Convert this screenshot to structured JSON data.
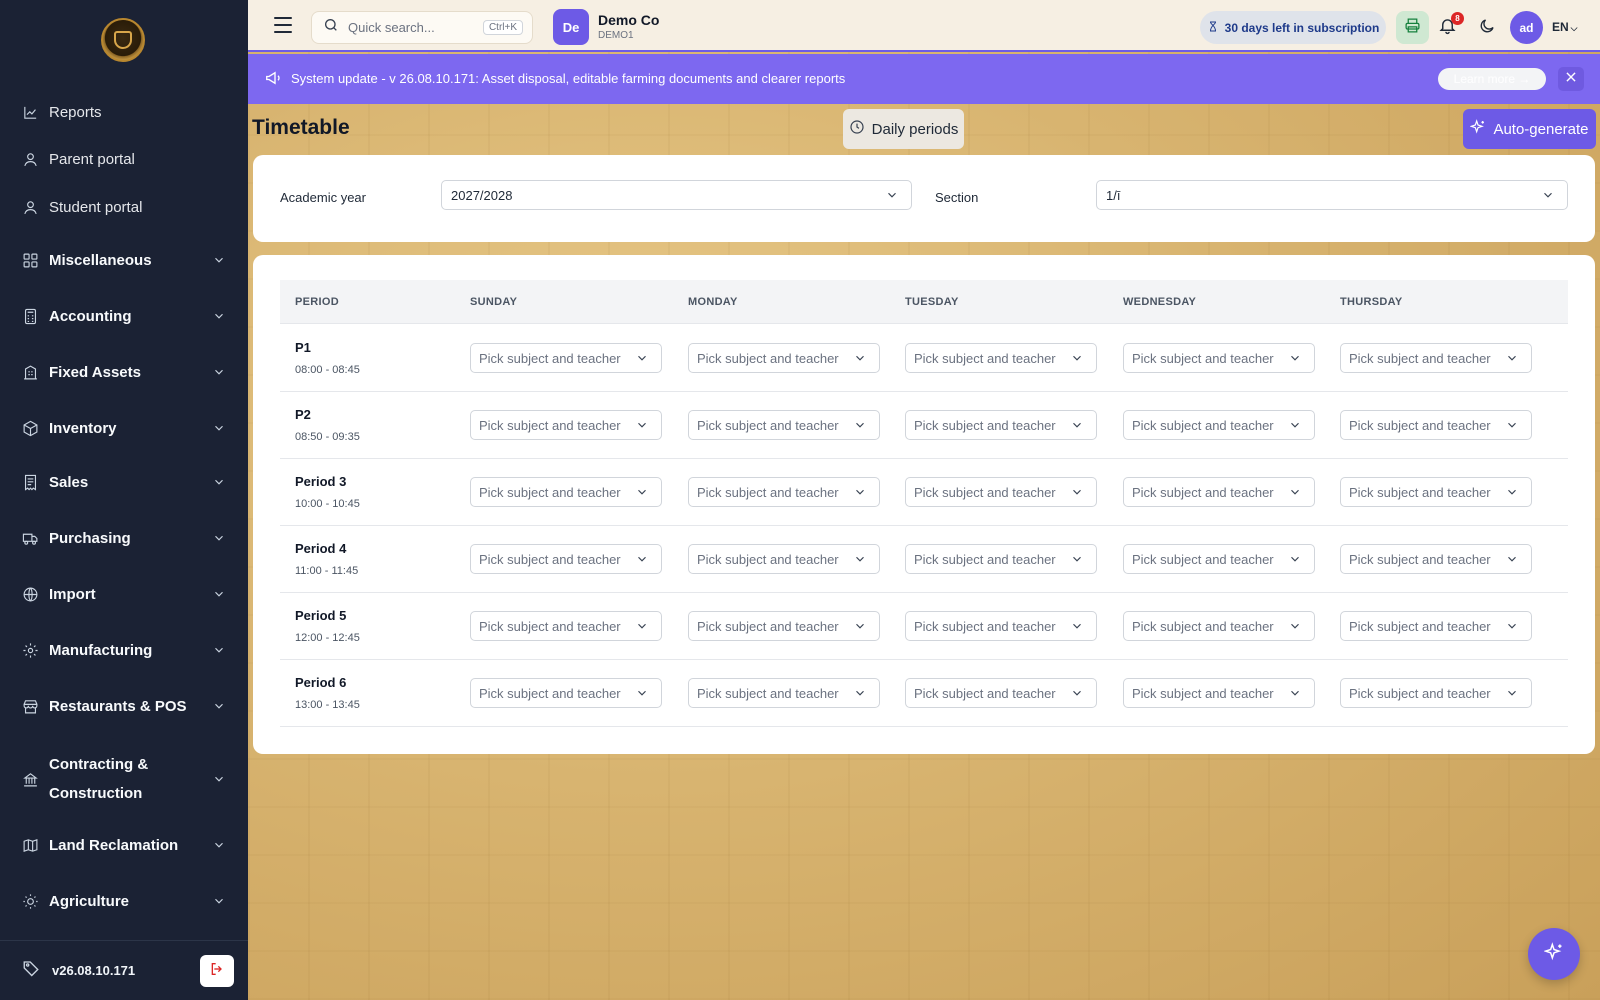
{
  "sidebar": {
    "items": [
      {
        "label": "Reports",
        "icon": "chart-line-icon",
        "bold": false,
        "expandable": false
      },
      {
        "label": "Parent portal",
        "icon": "user-icon",
        "bold": false,
        "expandable": false
      },
      {
        "label": "Student portal",
        "icon": "user-icon",
        "bold": false,
        "expandable": false
      },
      {
        "label": "Miscellaneous",
        "icon": "grid-icon",
        "bold": true,
        "expandable": true
      },
      {
        "label": "Accounting",
        "icon": "calculator-icon",
        "bold": true,
        "expandable": true
      },
      {
        "label": "Fixed Assets",
        "icon": "building-icon",
        "bold": true,
        "expandable": true
      },
      {
        "label": "Inventory",
        "icon": "box-icon",
        "bold": true,
        "expandable": true
      },
      {
        "label": "Sales",
        "icon": "receipt-icon",
        "bold": true,
        "expandable": true
      },
      {
        "label": "Purchasing",
        "icon": "truck-icon",
        "bold": true,
        "expandable": true
      },
      {
        "label": "Import",
        "icon": "globe-icon",
        "bold": true,
        "expandable": true
      },
      {
        "label": "Manufacturing",
        "icon": "cog-icon",
        "bold": true,
        "expandable": true
      },
      {
        "label": "Restaurants & POS",
        "icon": "store-icon",
        "bold": true,
        "expandable": true
      },
      {
        "label_line1": "Contracting &",
        "label_line2": "Construction",
        "icon": "landmark-icon",
        "bold": true,
        "expandable": true
      },
      {
        "label": "Land Reclamation",
        "icon": "map-icon",
        "bold": true,
        "expandable": true
      },
      {
        "label": "Agriculture",
        "icon": "sun-icon",
        "bold": true,
        "expandable": true
      }
    ],
    "version": "v26.08.10.171"
  },
  "topbar": {
    "search_placeholder": "Quick search...",
    "search_shortcut": "Ctrl+K",
    "company_initials": "De",
    "company_name": "Demo Co",
    "company_code": "DEMO1",
    "subscription": "30 days left in subscription",
    "notification_count": "8",
    "user_initials": "ad",
    "language": "EN"
  },
  "banner": {
    "message": "System update - v 26.08.10.171: Asset disposal, editable farming documents and clearer reports",
    "learn_more": "Learn more →"
  },
  "page": {
    "title": "Timetable",
    "daily_periods_label": "Daily periods",
    "auto_generate_label": "Auto-generate"
  },
  "filters": {
    "academic_year_label": "Academic year",
    "academic_year_value": "2027/2028",
    "section_label": "Section",
    "section_value": "1/ī"
  },
  "timetable": {
    "columns": [
      "PERIOD",
      "SUNDAY",
      "MONDAY",
      "TUESDAY",
      "WEDNESDAY",
      "THURSDAY"
    ],
    "cell_placeholder": "Pick subject and teacher",
    "periods": [
      {
        "name": "P1",
        "time": "08:00 - 08:45"
      },
      {
        "name": "P2",
        "time": "08:50 - 09:35"
      },
      {
        "name": "Period 3",
        "time": "10:00 - 10:45"
      },
      {
        "name": "Period 4",
        "time": "11:00 - 11:45"
      },
      {
        "name": "Period 5",
        "time": "12:00 - 12:45"
      },
      {
        "name": "Period 6",
        "time": "13:00 - 13:45"
      }
    ]
  },
  "colors": {
    "accent": "#6d5ae6",
    "banner": "#7d68f0",
    "sidebar": "#1b2234"
  }
}
